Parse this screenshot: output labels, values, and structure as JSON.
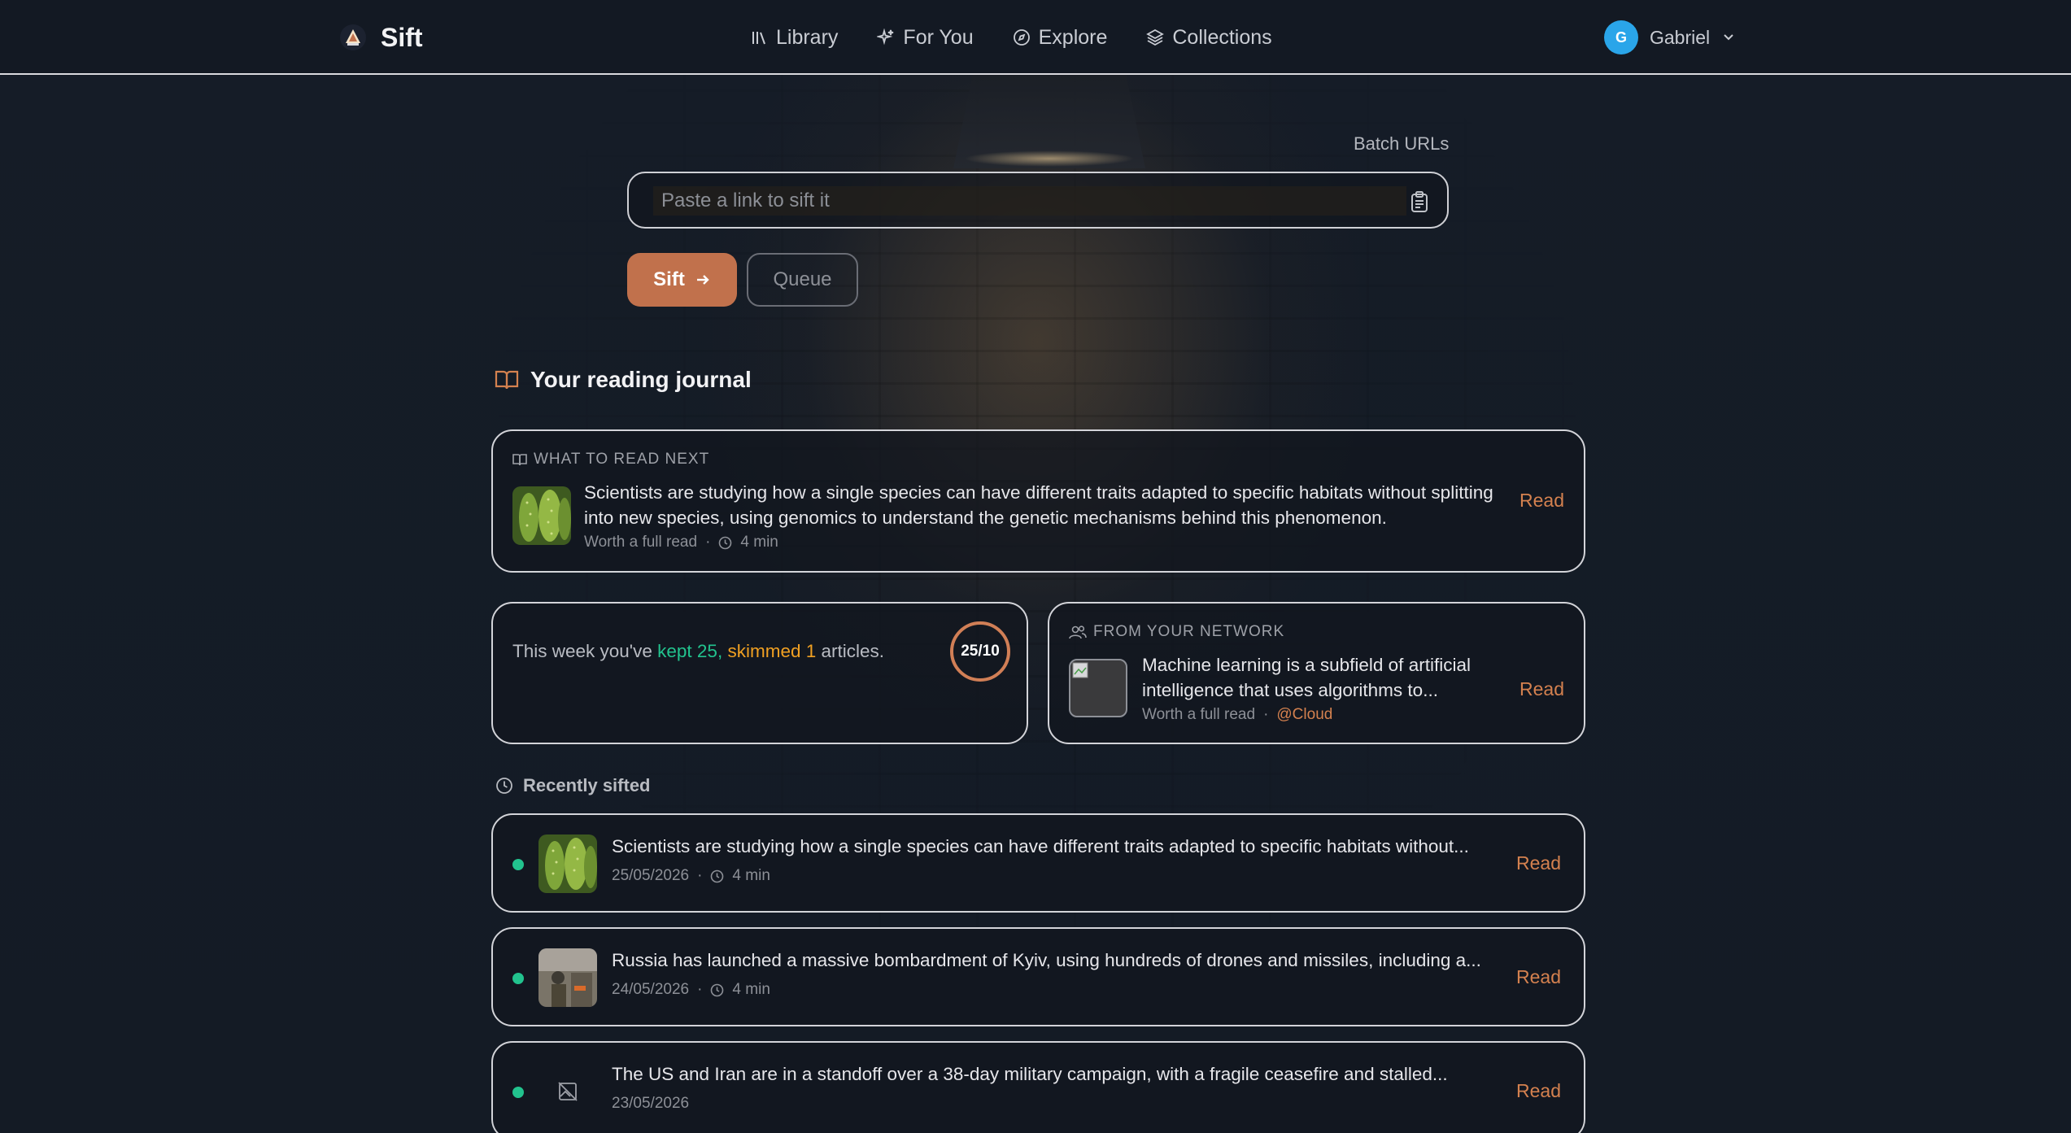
{
  "app": {
    "name": "Sift"
  },
  "nav": [
    {
      "label": "Library",
      "icon": "library-icon"
    },
    {
      "label": "For You",
      "icon": "sparkle-icon"
    },
    {
      "label": "Explore",
      "icon": "compass-icon"
    },
    {
      "label": "Collections",
      "icon": "layers-icon"
    }
  ],
  "user": {
    "initial": "G",
    "name": "Gabriel",
    "avatar_color": "#2aa5e9"
  },
  "sift": {
    "batch_label": "Batch URLs",
    "placeholder": "Paste a link to sift it",
    "value": "",
    "sift_label": "Sift",
    "queue_label": "Queue"
  },
  "journal": {
    "title": "Your reading journal",
    "next": {
      "label": "WHAT TO READ NEXT",
      "text": "Scientists are studying how a single species can have different traits adapted to specific habitats without splitting into new species, using genomics to understand the genetic mechanisms behind this phenomenon.",
      "verdict": "Worth a full read",
      "time": "4 min",
      "read": "Read"
    },
    "week": {
      "prefix": "This week you've",
      "kept": "kept 25,",
      "skimmed": "skimmed 1",
      "suffix": "articles.",
      "ring": "25/10",
      "kept_color": "#22c38e",
      "skimmed_color": "#f0a022"
    },
    "network": {
      "label": "FROM YOUR NETWORK",
      "text": "Machine learning is a subfield of artificial intelligence that uses algorithms to...",
      "verdict": "Worth a full read",
      "handle": "@Cloud",
      "read": "Read"
    }
  },
  "recent": {
    "title": "Recently sifted",
    "items": [
      {
        "text": "Scientists are studying how a single species can have different traits adapted to specific habitats without...",
        "date": "25/05/2026",
        "time": "4 min",
        "read": "Read",
        "thumb": "cactus"
      },
      {
        "text": "Russia has launched a massive bombardment of Kyiv, using hundreds of drones and missiles, including a...",
        "date": "24/05/2026",
        "time": "4 min",
        "read": "Read",
        "thumb": "photo"
      },
      {
        "text": "The US and Iran are in a standoff over a 38-day military campaign, with a fragile ceasefire and stalled...",
        "date": "23/05/2026",
        "time": "",
        "read": "Read",
        "thumb": "none"
      }
    ]
  },
  "colors": {
    "accent": "#c1714c",
    "read_link": "#d4814f",
    "status_dot": "#22c38e"
  }
}
